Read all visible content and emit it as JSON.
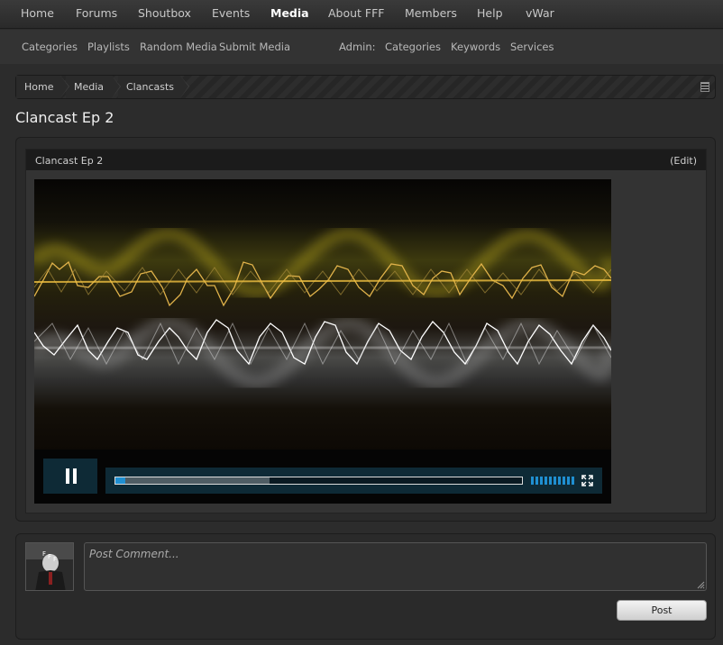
{
  "nav": {
    "items": [
      {
        "label": "Home",
        "active": false
      },
      {
        "label": "Forums",
        "active": false
      },
      {
        "label": "Shoutbox",
        "active": false
      },
      {
        "label": "Events",
        "active": false
      },
      {
        "label": "Media",
        "active": true
      },
      {
        "label": "About FFF",
        "active": false
      },
      {
        "label": "Members",
        "active": false
      },
      {
        "label": "Help",
        "active": false
      },
      {
        "label": "vWar",
        "active": false
      }
    ]
  },
  "subnav": {
    "items": [
      "Categories",
      "Playlists",
      "Random Media",
      "Submit Media"
    ],
    "admin_label": "Admin:",
    "admin_items": [
      "Categories",
      "Keywords",
      "Services"
    ]
  },
  "breadcrumb": {
    "items": [
      "Home",
      "Media",
      "Clancasts"
    ],
    "menu_icon": "list-icon"
  },
  "page": {
    "title": "Clancast Ep 2"
  },
  "media": {
    "name": "Clancast Ep 2",
    "edit_label": "(Edit)",
    "player": {
      "state": "playing",
      "played_fraction": 0.025,
      "buffered_fraction": 0.38,
      "volume_fraction": 1.0,
      "accent_color": "#1f8fd1",
      "control_bg_color": "#0e2a36",
      "icons": [
        "pause-icon",
        "volume-icon",
        "fullscreen-icon"
      ]
    }
  },
  "comment": {
    "placeholder": "Post Comment...",
    "submit_label": "Post"
  },
  "colors": {
    "background": "#2c2c2c",
    "panel": "#2a2a2a",
    "nav": "#333333"
  }
}
